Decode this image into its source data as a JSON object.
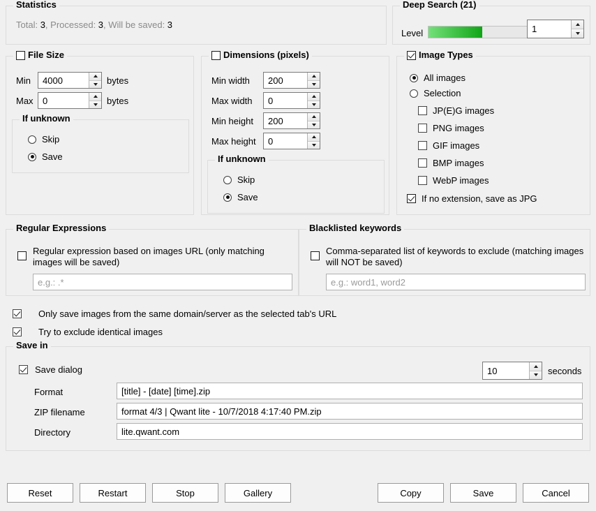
{
  "statistics": {
    "title": "Statistics",
    "line_prefix_total": "Total: ",
    "total": "3",
    "sep1": ", Processed: ",
    "processed": "3",
    "sep2": ", Will be saved: ",
    "will_be_saved": "3"
  },
  "deep_search": {
    "title": "Deep Search (21)",
    "level_label": "Level",
    "level_value": "1",
    "progress_percent": 40
  },
  "file_size": {
    "title": "File Size",
    "checked": false,
    "min_label": "Min",
    "min_value": "4000",
    "min_unit": "bytes",
    "max_label": "Max",
    "max_value": "0",
    "max_unit": "bytes",
    "if_unknown": {
      "title": "If unknown",
      "skip_label": "Skip",
      "save_label": "Save",
      "selected": "Save"
    }
  },
  "dimensions": {
    "title": "Dimensions (pixels)",
    "checked": false,
    "min_width_label": "Min width",
    "min_width_value": "200",
    "max_width_label": "Max width",
    "max_width_value": "0",
    "min_height_label": "Min height",
    "min_height_value": "200",
    "max_height_label": "Max height",
    "max_height_value": "0",
    "if_unknown": {
      "title": "If unknown",
      "skip_label": "Skip",
      "save_label": "Save",
      "selected": "Save"
    }
  },
  "image_types": {
    "title": "Image Types",
    "checked": true,
    "all_images_label": "All images",
    "selection_label": "Selection",
    "selected_mode": "All images",
    "types": [
      {
        "label": "JP(E)G images",
        "checked": false
      },
      {
        "label": "PNG images",
        "checked": false
      },
      {
        "label": "GIF images",
        "checked": false
      },
      {
        "label": "BMP images",
        "checked": false
      },
      {
        "label": "WebP images",
        "checked": false
      }
    ],
    "no_extension_label": "If no extension, save as JPG",
    "no_extension_checked": true
  },
  "regular_expressions": {
    "title": "Regular Expressions",
    "checkbox_label": "Regular expression based on images URL (only matching images will be saved)",
    "checked": false,
    "input_placeholder": "e.g.: .*",
    "input_value": ""
  },
  "blacklisted_keywords": {
    "title": "Blacklisted keywords",
    "checkbox_label": "Comma-separated list of keywords to exclude (matching images will NOT be saved)",
    "checked": false,
    "input_placeholder": "e.g.: word1, word2",
    "input_value": ""
  },
  "global_options": [
    {
      "label": "Only save images from the same domain/server as the selected tab's URL",
      "checked": true
    },
    {
      "label": "Try to exclude identical images",
      "checked": true
    }
  ],
  "save_in": {
    "title": "Save in",
    "save_dialog_label": "Save dialog",
    "save_dialog_checked": true,
    "seconds_value": "10",
    "seconds_label": "seconds",
    "format_label": "Format",
    "format_value": "[title] - [date] [time].zip",
    "zip_filename_label": "ZIP filename",
    "zip_filename_value": "format 4/3 | Qwant lite - 10/7/2018 4:17:40 PM.zip",
    "directory_label": "Directory",
    "directory_value": "lite.qwant.com"
  },
  "buttons": {
    "reset": "Reset",
    "restart": "Restart",
    "stop": "Stop",
    "gallery": "Gallery",
    "copy": "Copy",
    "save": "Save",
    "cancel": "Cancel"
  },
  "colors": {
    "progress_start": "#74e07a",
    "progress_end": "#10a516",
    "background": "#f0f0f0"
  }
}
